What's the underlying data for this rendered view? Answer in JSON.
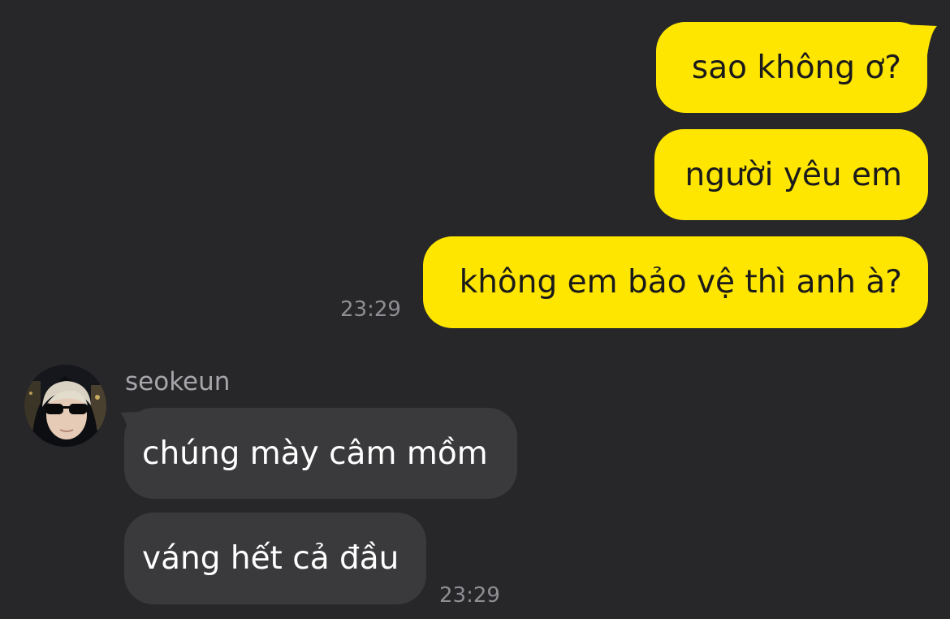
{
  "conversation": {
    "outgoing": [
      {
        "text": "sao không ơ?"
      },
      {
        "text": "người yêu em"
      },
      {
        "text": "không em bảo vệ thì anh à?"
      }
    ],
    "outgoing_time": "23:29",
    "sender": {
      "name": "seokeun",
      "avatar_icon": "user-avatar-photo"
    },
    "incoming": [
      {
        "text": "chúng mày câm mồm"
      },
      {
        "text": "váng hết cả đầu"
      }
    ],
    "incoming_time": "23:29"
  },
  "colors": {
    "background": "#272729",
    "outgoing_bubble": "#FFE600",
    "incoming_bubble": "#3a3a3c",
    "timestamp": "#8e8e93",
    "sender_name": "#a6a6aa"
  }
}
